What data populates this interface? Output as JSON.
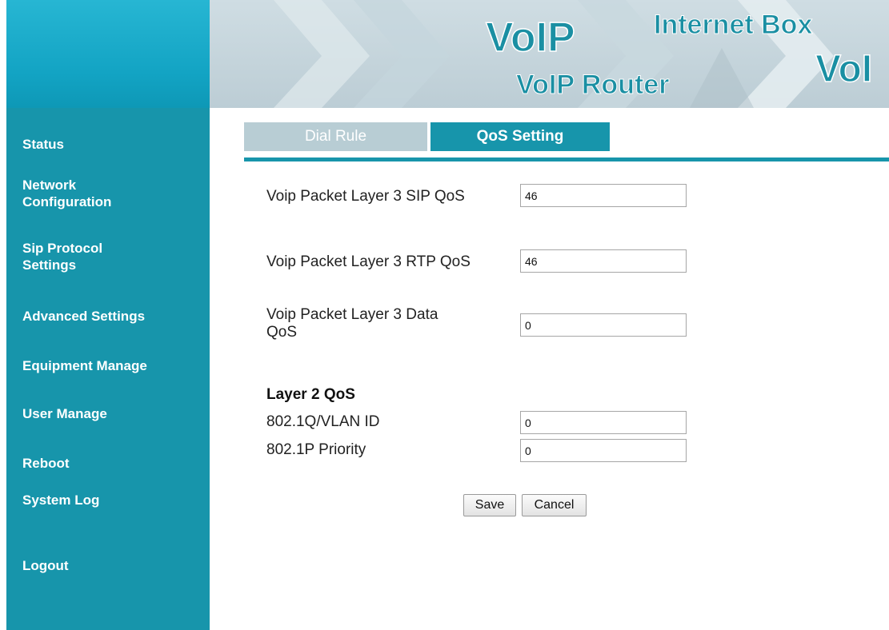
{
  "banner": {
    "voip_big": "VoIP",
    "router_text": "VoIP Router",
    "internet_box": "Internet Box",
    "voi_partial": "VoI"
  },
  "sidebar": {
    "items": [
      {
        "label": "Status"
      },
      {
        "label": "Network Configuration",
        "lines": [
          "Network",
          "Configuration"
        ]
      },
      {
        "label": "Sip Protocol Settings",
        "lines": [
          "Sip Protocol",
          "Settings"
        ]
      },
      {
        "label": "Advanced Settings"
      },
      {
        "label": "Equipment Manage"
      },
      {
        "label": "User Manage"
      },
      {
        "label": "Reboot"
      },
      {
        "label": "System Log"
      },
      {
        "label": "Logout"
      }
    ]
  },
  "tabs": [
    {
      "label": "Dial Rule",
      "active": false
    },
    {
      "label": "QoS Setting",
      "active": true
    }
  ],
  "form": {
    "sip_qos_label": "Voip Packet Layer 3 SIP QoS",
    "sip_qos_value": "46",
    "rtp_qos_label": "Voip Packet Layer 3 RTP QoS",
    "rtp_qos_value": "46",
    "data_qos_label_line1": "Voip Packet Layer 3 Data",
    "data_qos_label_line2": "QoS",
    "data_qos_value": "0",
    "layer2_title": "Layer 2 QoS",
    "vlan_label": "802.1Q/VLAN ID",
    "vlan_value": "0",
    "priority_label": "802.1P Priority",
    "priority_value": "0"
  },
  "buttons": {
    "save": "Save",
    "cancel": "Cancel"
  },
  "colors": {
    "accent": "#1795ab",
    "sidebar_top": "#1aa8c5",
    "banner_text": "#1a8fa3",
    "tab_inactive": "#b8cdd4"
  }
}
